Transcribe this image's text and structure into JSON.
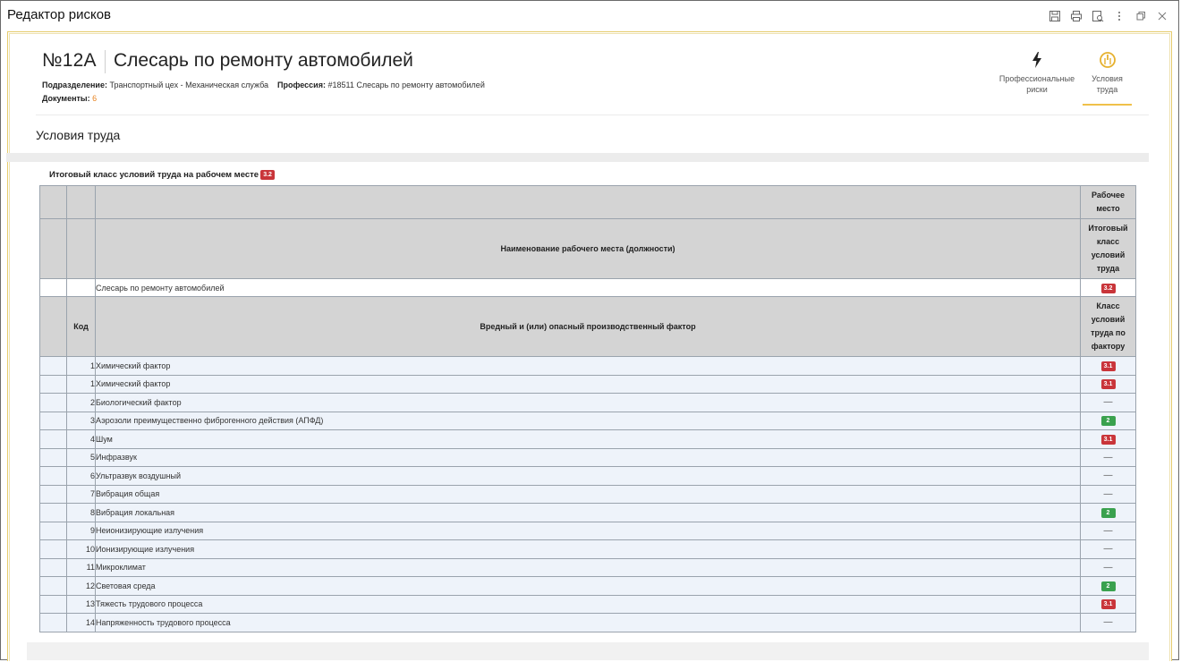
{
  "window": {
    "title": "Редактор рисков",
    "icons": [
      "save-icon",
      "print-icon",
      "preview-icon",
      "more-icon",
      "restore-icon",
      "close-icon"
    ]
  },
  "header": {
    "number": "№12А",
    "name": "Слесарь по ремонту автомобилей",
    "division_label": "Подразделение:",
    "division_value": "Транспортный цех - Механическая служба",
    "profession_label": "Профессия:",
    "profession_value": "#18511 Слесарь по ремонту автомобилей",
    "documents_label": "Документы:",
    "documents_value": "6"
  },
  "tabs": [
    {
      "label_line1": "Профессиональные",
      "label_line2": "риски",
      "icon": "lightning-icon",
      "active": false
    },
    {
      "label_line1": "Условия",
      "label_line2": "труда",
      "icon": "gauge-icon",
      "active": true
    }
  ],
  "section": {
    "title": "Условия труда",
    "final_class_label": "Итоговый класс условий труда на рабочем месте",
    "final_class_value": "3.2"
  },
  "table": {
    "h_workplace": "Рабочее место",
    "h_workplace_name": "Наименование рабочего места (должности)",
    "h_final_class": "Итоговый класс условий труда",
    "workplace_row": {
      "name": "Слесарь по ремонту автомобилей",
      "class": "3.2"
    },
    "h_code": "Код",
    "h_factor": "Вредный и (или) опасный производственный фактор",
    "h_factor_class": "Класс условий труда по фактору",
    "rows": [
      {
        "code": "1",
        "factor": "Химический фактор",
        "class": "3.1",
        "type": "red"
      },
      {
        "code": "1",
        "factor": "Химический фактор",
        "class": "3.1",
        "type": "red"
      },
      {
        "code": "2",
        "factor": "Биологический фактор",
        "class": "—",
        "type": "dash"
      },
      {
        "code": "3",
        "factor": "Аэрозоли преимущественно фиброгенного действия (АПФД)",
        "class": "2",
        "type": "green"
      },
      {
        "code": "4",
        "factor": "Шум",
        "class": "3.1",
        "type": "red"
      },
      {
        "code": "5",
        "factor": "Инфразвук",
        "class": "—",
        "type": "dash"
      },
      {
        "code": "6",
        "factor": "Ультразвук воздушный",
        "class": "—",
        "type": "dash"
      },
      {
        "code": "7",
        "factor": "Вибрация общая",
        "class": "—",
        "type": "dash"
      },
      {
        "code": "8",
        "factor": "Вибрация локальная",
        "class": "2",
        "type": "green"
      },
      {
        "code": "9",
        "factor": "Неионизирующие излучения",
        "class": "—",
        "type": "dash"
      },
      {
        "code": "10",
        "factor": "Ионизирующие излучения",
        "class": "—",
        "type": "dash"
      },
      {
        "code": "11",
        "factor": "Микроклимат",
        "class": "—",
        "type": "dash"
      },
      {
        "code": "12",
        "factor": "Световая среда",
        "class": "2",
        "type": "green"
      },
      {
        "code": "13",
        "factor": "Тяжесть трудового процесса",
        "class": "3.1",
        "type": "red"
      },
      {
        "code": "14",
        "factor": "Напряженность трудового процесса",
        "class": "—",
        "type": "dash"
      }
    ]
  },
  "colors": {
    "accent": "#f0c14a",
    "danger": "#c9353a",
    "ok": "#3aa14e",
    "link": "#e8821e"
  }
}
